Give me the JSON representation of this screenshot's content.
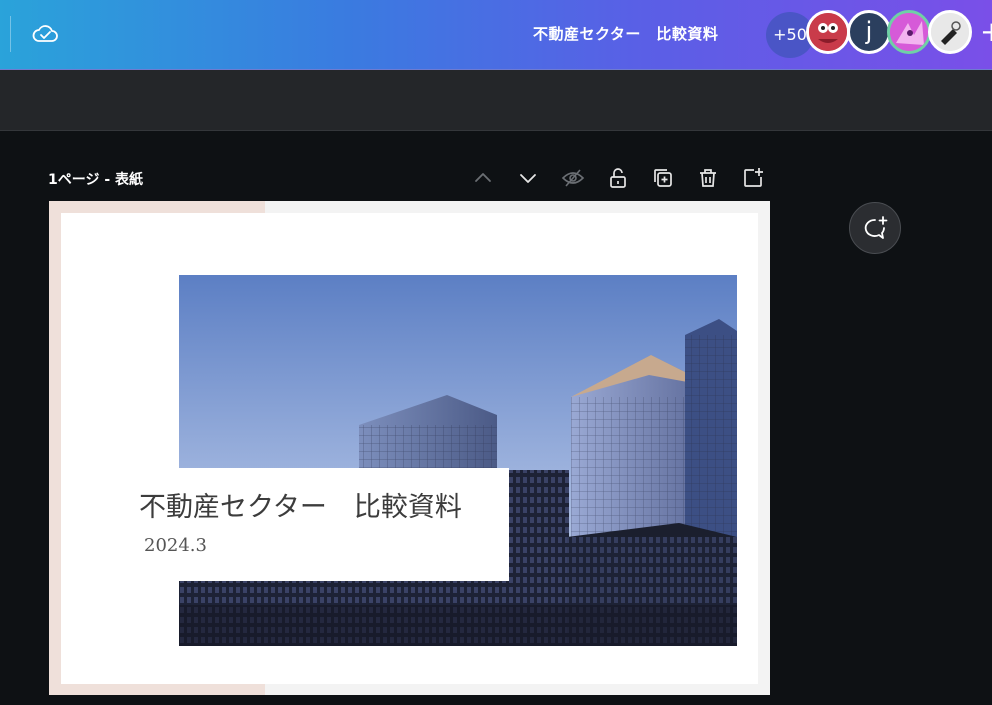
{
  "header": {
    "document_title": "不動産セクター　比較資料",
    "collaborator_count": "+50",
    "avatar_letter": "j",
    "icons": [
      "cloud-check-icon",
      "plus-icon"
    ],
    "gradient": [
      "#2aa3da",
      "#7a4fe8"
    ]
  },
  "page": {
    "label": "1ページ - 表紙",
    "controls": [
      "chevron-up-icon",
      "chevron-down-icon",
      "hide-icon",
      "unlock-icon",
      "duplicate-icon",
      "trash-icon",
      "add-page-icon"
    ]
  },
  "slide": {
    "title": "不動産セクター　比較資料",
    "date": "2024.3",
    "accent_color": "#efe0da"
  },
  "comment": {
    "icon": "add-comment-icon"
  }
}
